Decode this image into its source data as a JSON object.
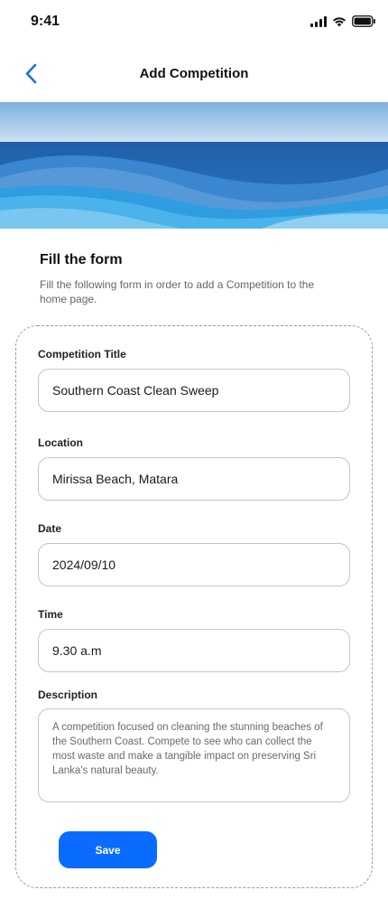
{
  "status_bar": {
    "time": "9:41"
  },
  "nav": {
    "title": "Add Competition"
  },
  "intro": {
    "title": "Fill the form",
    "subtitle": "Fill the following form in order to add a Competition to the home page."
  },
  "form": {
    "competition_title": {
      "label": "Competition Title",
      "value": "Southern Coast Clean Sweep"
    },
    "location": {
      "label": "Location",
      "value": "Mirissa Beach, Matara"
    },
    "date": {
      "label": "Date",
      "value": "2024/09/10"
    },
    "time": {
      "label": "Time",
      "value": "9.30 a.m"
    },
    "description": {
      "label": "Description",
      "value": "A competition focused on cleaning the stunning beaches of the Southern Coast. Compete to see who can collect the most waste and make a tangible impact on preserving Sri Lanka's natural beauty."
    },
    "save_label": "Save"
  },
  "colors": {
    "accent": "#0a6cff",
    "ocean": "#2a7fd0"
  },
  "icons": {
    "back": "chevron-left-icon",
    "signal": "signal-icon",
    "wifi": "wifi-icon",
    "battery": "battery-icon"
  }
}
